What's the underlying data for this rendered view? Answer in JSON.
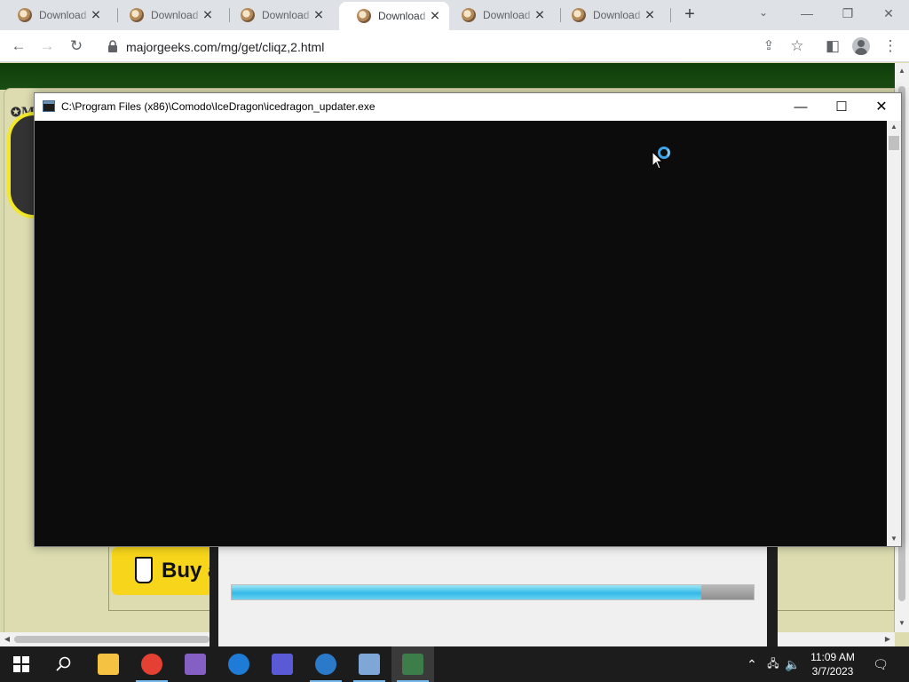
{
  "browser": {
    "tabs": [
      {
        "title": "Download",
        "active": false
      },
      {
        "title": "Download",
        "active": false
      },
      {
        "title": "Download",
        "active": false
      },
      {
        "title": "Download",
        "active": true
      },
      {
        "title": "Download",
        "active": false
      },
      {
        "title": "Download",
        "active": false
      }
    ],
    "close_glyph": "✕",
    "new_tab_glyph": "+",
    "tab_search_glyph": "⌄",
    "window_controls": {
      "minimize": "—",
      "restore": "❐",
      "close": "✕"
    },
    "toolbar": {
      "back_glyph": "←",
      "forward_glyph": "→",
      "reload_glyph": "↻",
      "url": "majorgeeks.com/mg/get/cliqz,2.html",
      "share_glyph": "⇪",
      "bookmark_glyph": "☆",
      "sidepanel_glyph": "◧",
      "menu_glyph": "⋮"
    }
  },
  "page": {
    "logo_text": "✪M",
    "buy_button_label": "Buy a",
    "installer_progress": 0.9
  },
  "console_window": {
    "title": "C:\\Program Files (x86)\\Comodo\\IceDragon\\icedragon_updater.exe",
    "minimize_glyph": "—",
    "maximize_glyph": "☐",
    "close_glyph": "✕"
  },
  "taskbar": {
    "apps": [
      {
        "name": "file-explorer",
        "color": "#f5c242",
        "running": false,
        "active": false
      },
      {
        "name": "chrome",
        "color": "#e44134",
        "running": true,
        "active": false
      },
      {
        "name": "visual-studio",
        "color": "#865fc5",
        "running": false,
        "active": false
      },
      {
        "name": "ccleaner",
        "color": "#1e7bd6",
        "running": false,
        "active": false
      },
      {
        "name": "p-app",
        "color": "#5a5ad6",
        "running": false,
        "active": false
      },
      {
        "name": "comodo-dragon",
        "color": "#2a7ac9",
        "running": true,
        "active": false
      },
      {
        "name": "setup-app",
        "color": "#7ea6d6",
        "running": true,
        "active": false
      },
      {
        "name": "console-app",
        "color": "#3d7d4a",
        "running": true,
        "active": true
      }
    ],
    "clock": {
      "time": "11:09 AM",
      "date": "3/7/2023"
    }
  }
}
